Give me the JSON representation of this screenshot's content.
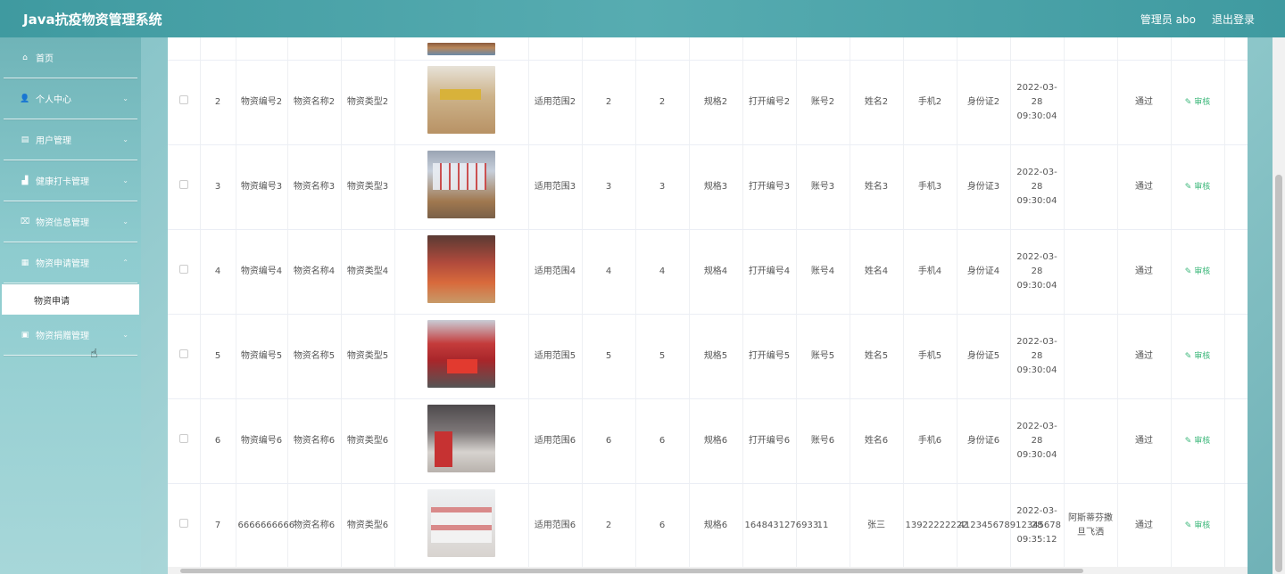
{
  "header": {
    "title": "Java抗疫物资管理系统",
    "user": "管理员 abo",
    "logout": "退出登录"
  },
  "sidebar": {
    "items": [
      {
        "label": "首页",
        "icon": "home-icon",
        "glyph": "⌂"
      },
      {
        "label": "个人中心",
        "icon": "user-icon",
        "glyph": "👤"
      },
      {
        "label": "用户管理",
        "icon": "document-icon",
        "glyph": "▤"
      },
      {
        "label": "健康打卡管理",
        "icon": "chart-icon",
        "glyph": "▟"
      },
      {
        "label": "物资信息管理",
        "icon": "box-icon",
        "glyph": "⌧"
      },
      {
        "label": "物资申请管理",
        "icon": "folder-icon",
        "glyph": "▦"
      },
      {
        "label": "物资捐赠管理",
        "icon": "clipboard-icon",
        "glyph": "▣"
      }
    ],
    "submenu_active": "物资申请"
  },
  "table": {
    "rows": [
      {
        "id": "2",
        "code": "物资编号2",
        "name": "物资名称2",
        "type": "物资类型2",
        "scope": "适用范围2",
        "qty1": "2",
        "qty2": "2",
        "spec": "规格2",
        "pkg": "打开编号2",
        "account": "账号2",
        "person": "姓名2",
        "phone": "手机2",
        "idcard": "身份证2",
        "time": "2022-03-28 09:30:04",
        "note": "",
        "status": "通过",
        "action": "审核"
      },
      {
        "id": "3",
        "code": "物资编号3",
        "name": "物资名称3",
        "type": "物资类型3",
        "scope": "适用范围3",
        "qty1": "3",
        "qty2": "3",
        "spec": "规格3",
        "pkg": "打开编号3",
        "account": "账号3",
        "person": "姓名3",
        "phone": "手机3",
        "idcard": "身份证3",
        "time": "2022-03-28 09:30:04",
        "note": "",
        "status": "通过",
        "action": "审核"
      },
      {
        "id": "4",
        "code": "物资编号4",
        "name": "物资名称4",
        "type": "物资类型4",
        "scope": "适用范围4",
        "qty1": "4",
        "qty2": "4",
        "spec": "规格4",
        "pkg": "打开编号4",
        "account": "账号4",
        "person": "姓名4",
        "phone": "手机4",
        "idcard": "身份证4",
        "time": "2022-03-28 09:30:04",
        "note": "",
        "status": "通过",
        "action": "审核"
      },
      {
        "id": "5",
        "code": "物资编号5",
        "name": "物资名称5",
        "type": "物资类型5",
        "scope": "适用范围5",
        "qty1": "5",
        "qty2": "5",
        "spec": "规格5",
        "pkg": "打开编号5",
        "account": "账号5",
        "person": "姓名5",
        "phone": "手机5",
        "idcard": "身份证5",
        "time": "2022-03-28 09:30:04",
        "note": "",
        "status": "通过",
        "action": "审核"
      },
      {
        "id": "6",
        "code": "物资编号6",
        "name": "物资名称6",
        "type": "物资类型6",
        "scope": "适用范围6",
        "qty1": "6",
        "qty2": "6",
        "spec": "规格6",
        "pkg": "打开编号6",
        "account": "账号6",
        "person": "姓名6",
        "phone": "手机6",
        "idcard": "身份证6",
        "time": "2022-03-28 09:30:04",
        "note": "",
        "status": "通过",
        "action": "审核"
      },
      {
        "id": "7",
        "code": "6666666666",
        "name": "物资名称6",
        "type": "物资类型6",
        "scope": "适用范围6",
        "qty1": "2",
        "qty2": "6",
        "spec": "规格6",
        "pkg": "1648431276933",
        "account": "11",
        "person": "张三",
        "phone": "13922222222",
        "idcard": "412345678912345678",
        "time": "2022-03-28 09:35:12",
        "note": "阿斯蒂芬撒旦飞洒",
        "status": "通过",
        "action": "审核"
      }
    ]
  }
}
